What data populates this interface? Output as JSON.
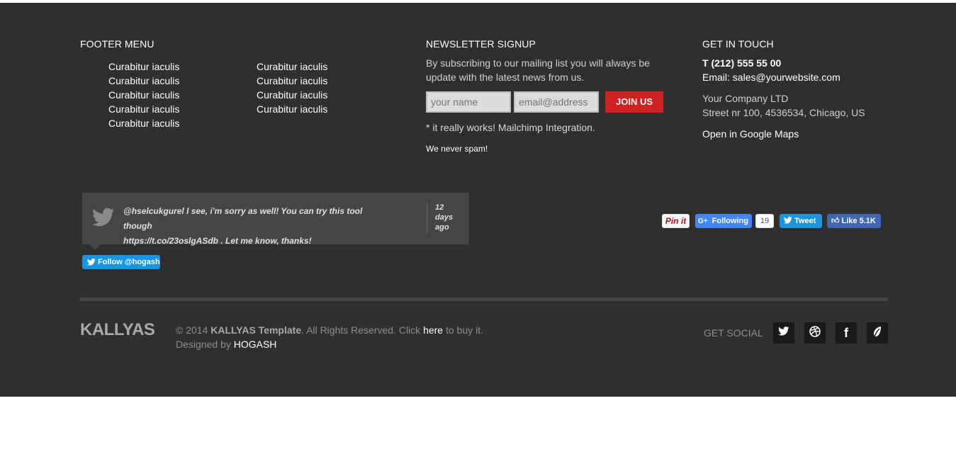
{
  "footer_menu": {
    "title": "FOOTER MENU",
    "col1": [
      "Curabitur iaculis",
      "Curabitur iaculis",
      "Curabitur iaculis",
      "Curabitur iaculis",
      "Curabitur iaculis"
    ],
    "col2": [
      "Curabitur iaculis",
      "Curabitur iaculis",
      "Curabitur iaculis",
      "Curabitur iaculis"
    ]
  },
  "newsletter": {
    "title": "NEWSLETTER SIGNUP",
    "text_line1": "By subscribing to our mailing list you will always be",
    "text_line2": "update with the latest news from us.",
    "name_placeholder": "your name",
    "email_placeholder": "email@address",
    "join_label": "JOIN US",
    "note": "* it really works! Mailchimp Integration.",
    "no_spam": "We never spam!"
  },
  "contact": {
    "title": "GET IN TOUCH",
    "phone": "T (212) 555 55 00",
    "email_label": "Email: ",
    "email": "sales@yourwebsite.com",
    "company": "Your Company LTD",
    "address": "Street nr 100, 4536534, Chicago, US",
    "maps_link": "Open in Google Maps"
  },
  "tweet": {
    "line1": "@hselcukgurel I see, i'm sorry as well! You can try this tool though",
    "line2": "https://t.co/23oslgASdb . Let me know, thanks!",
    "time_1": "12",
    "time_2": "days",
    "time_3": "ago",
    "follow_label": "Follow @hogash"
  },
  "share": {
    "pin": "Pin it",
    "gplus": "Following",
    "gplus_count": "19",
    "tweet": "Tweet",
    "like": "Like 5.1K"
  },
  "bottom": {
    "logo": "KALLYAS",
    "copy_prefix": "© 2014 ",
    "copy_brand": "KALLYAS Template",
    "copy_mid": ". All Rights Reserved. Click ",
    "copy_link": "here",
    "copy_suffix": " to buy it.",
    "designed_by": "Designed by ",
    "designer": "HOGASH",
    "get_social": "GET SOCIAL"
  },
  "colors": {
    "footer_bg": "#2f2f2f",
    "accent_red": "#cd2122",
    "twitter_blue": "#1b95e0",
    "facebook_blue": "#4267b2",
    "gplus_blue": "#4285f4"
  },
  "social_icons": [
    "twitter-icon",
    "dribbble-icon",
    "facebook-icon",
    "envato-leaf-icon"
  ]
}
